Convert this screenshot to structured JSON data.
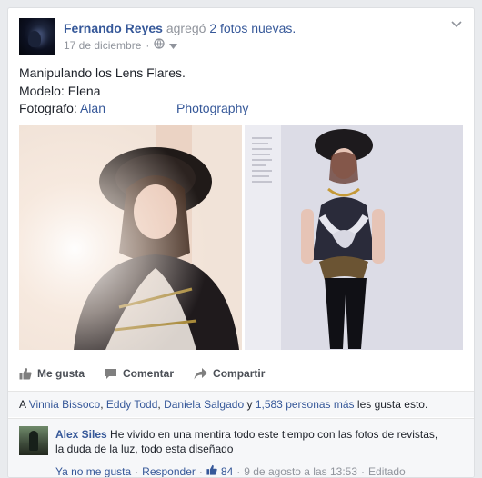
{
  "post": {
    "author": "Fernando Reyes",
    "action": "agregó",
    "count_link": "2 fotos nuevas.",
    "date": "17 de diciembre",
    "date_sep": "·",
    "text_line1": "Manipulando los Lens Flares.",
    "text_line2": "Modelo: Elena",
    "text_line3_prefix": "Fotografo:",
    "text_line3_link1": "Alan",
    "text_line3_link2": "Photography"
  },
  "actions": {
    "like": "Me gusta",
    "comment": "Comentar",
    "share": "Compartir"
  },
  "likes": {
    "prefix": "A",
    "name1": "Vinnia Bissoco",
    "sep1": ",",
    "name2": "Eddy Todd",
    "sep2": ",",
    "name3": "Daniela Salgado",
    "and": "y",
    "more": "1,583 personas más",
    "suffix": "les gusta esto."
  },
  "comment": {
    "author": "Alex Siles",
    "text_line1": "He vivido en una mentira todo este tiempo con las fotos de revistas,",
    "text_line2": "la duda de la luz, todo esta diseñado",
    "unlike": "Ya no me gusta",
    "reply": "Responder",
    "like_count": "84",
    "date": "9 de agosto a las 13:53",
    "edited": "Editado",
    "sep": "·"
  },
  "colors": {
    "link": "#365899",
    "muted": "#90949c",
    "text": "#1d2129",
    "bar_bg": "#f6f7f9"
  }
}
